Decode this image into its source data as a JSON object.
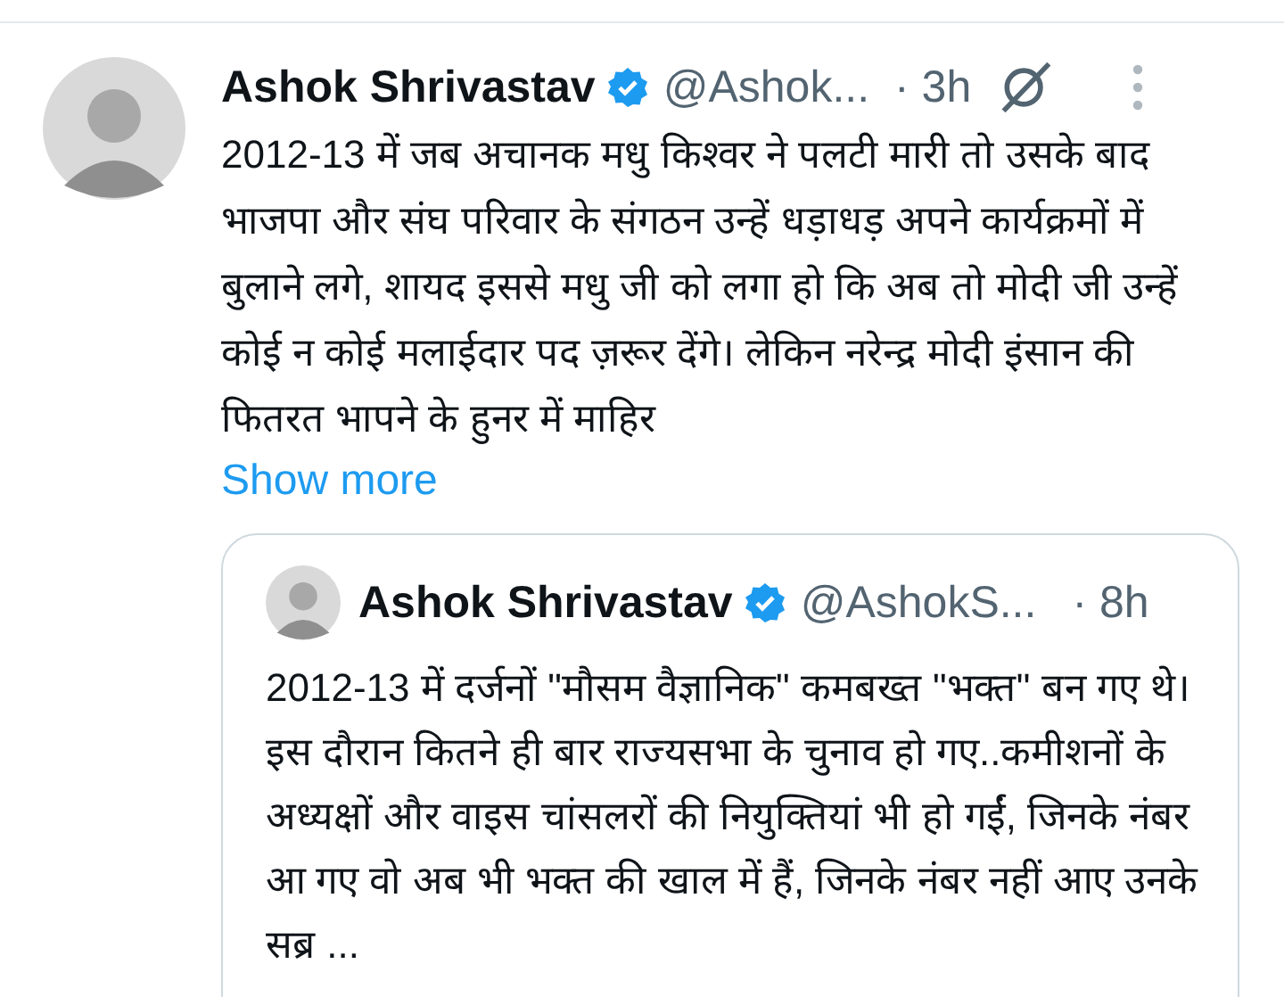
{
  "tweet": {
    "author": {
      "name": "Ashok Shrivastav",
      "verified": true,
      "handle": "@Ashok...",
      "time": "· 3h"
    },
    "text": "2012-13 में जब अचानक मधु किश्वर ने पलटी मारी तो उसके बाद भाजपा और संघ परिवार के संगठन उन्हें धड़ाधड़ अपने कार्यक्रमों में बुलाने लगे, शायद इससे मधु जी को लगा हो कि अब तो मोदी जी उन्हें कोई न कोई मलाईदार पद ज़रूर देंगे। लेकिन नरेन्द्र मोदी इंसान की फितरत भापने के हुनर में माहिर",
    "show_more": "Show more",
    "quoted": {
      "author": {
        "name": "Ashok Shrivastav",
        "verified": true,
        "handle": "@AshokS...",
        "time": "· 8h"
      },
      "text": "2012-13 में दर्जनों \"मौसम वैज्ञानिक\" कमबख्त  \"भक्त\" बन गए थे। इस दौरान कितने ही बार राज्यसभा के चुनाव हो गए..कमीशनों के अध्यक्षों और वाइस चांसलरों की नियुक्तियां भी हो गईं, जिनके नंबर आ गए वो अब भी भक्त की खाल में हैं, जिनके नंबर नहीं आए उनके सब्र ..."
    }
  }
}
